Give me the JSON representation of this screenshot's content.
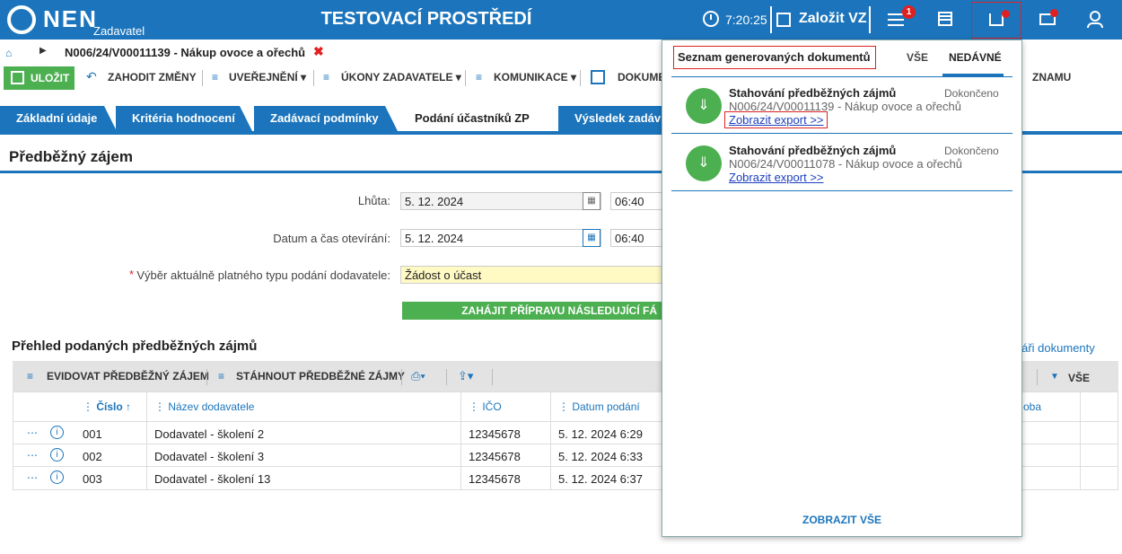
{
  "header": {
    "logo_text": "NEN",
    "logo_sub": "Zadavatel",
    "env_title": "TESTOVACÍ PROSTŘEDÍ",
    "clock_time": "7:20:25",
    "create_vz": "Založit VZ",
    "menu_badge": "1"
  },
  "breadcrumb": {
    "text": "N006/24/V00011139 - Nákup ovoce a ořechů"
  },
  "toolbar": {
    "save": "ULOŽIT",
    "discard": "ZAHODIT ZMĚNY",
    "publish": "UVEŘEJNĚNÍ",
    "actions": "ÚKONY ZADAVATELE",
    "communication": "KOMUNIKACE",
    "documents": "DOKUMEN",
    "record": "ZNAMU"
  },
  "tabs": [
    "Základní údaje",
    "Kritéria hodnocení",
    "Zadávací podmínky",
    "Podání účastníků ZP",
    "Výsledek zadáv"
  ],
  "section": {
    "title": "Předběžný zájem"
  },
  "form": {
    "deadline_label": "Lhůta:",
    "deadline_date": "5. 12. 2024",
    "deadline_time": "06:40",
    "opening_label": "Datum a čas otevírání:",
    "opening_date": "5. 12. 2024",
    "opening_time": "06:40",
    "required_mark": "*",
    "type_label": "Výběr aktuálně platného typu podání dodavatele:",
    "type_value": "Žádost o účast",
    "start_button": "ZAHÁJIT PŘÍPRAVU NÁSLEDUJÍCÍ FÁ"
  },
  "overview": {
    "title": "Přehled podaných předběžných zájmů",
    "link": "ulá​ři dokumenty",
    "btn_record": "EVIDOVAT PŘEDBĚŽNÝ ZÁJEM",
    "btn_download": "STÁHNOUT PŘEDBĚŽNÉ ZÁJMY",
    "btn_all": "VŠE",
    "columns": [
      "Číslo",
      "Název dodavatele",
      "IČO",
      "Datum podání",
      "oba"
    ],
    "rows": [
      {
        "num": "001",
        "name": "Dodavatel - školení 2",
        "ico": "12345678",
        "date": "5. 12. 2024 6:29"
      },
      {
        "num": "002",
        "name": "Dodavatel - školení 3",
        "ico": "12345678",
        "date": "5. 12. 2024 6:33"
      },
      {
        "num": "003",
        "name": "Dodavatel - školení 13",
        "ico": "12345678",
        "date": "5. 12. 2024 6:37"
      }
    ]
  },
  "popup": {
    "title": "Seznam generovaných dokumentů",
    "tab_all": "VŠE",
    "tab_recent": "NEDÁVNÉ",
    "entries": [
      {
        "title": "Stahování předběžných zájmů",
        "status": "Dokončeno",
        "sub": "N006/24/V00011139 - Nákup ovoce a ořechů",
        "link": "Zobrazit export >>"
      },
      {
        "title": "Stahování předběžných zájmů",
        "status": "Dokončeno",
        "sub": "N006/24/V00011078 - Nákup ovoce a ořechů",
        "link": "Zobrazit export >>"
      }
    ],
    "show_all": "ZOBRAZIT VŠE"
  },
  "colors": {
    "brand_blue": "#1c75bc",
    "green": "#4caf50",
    "alert_red": "#e02020"
  }
}
